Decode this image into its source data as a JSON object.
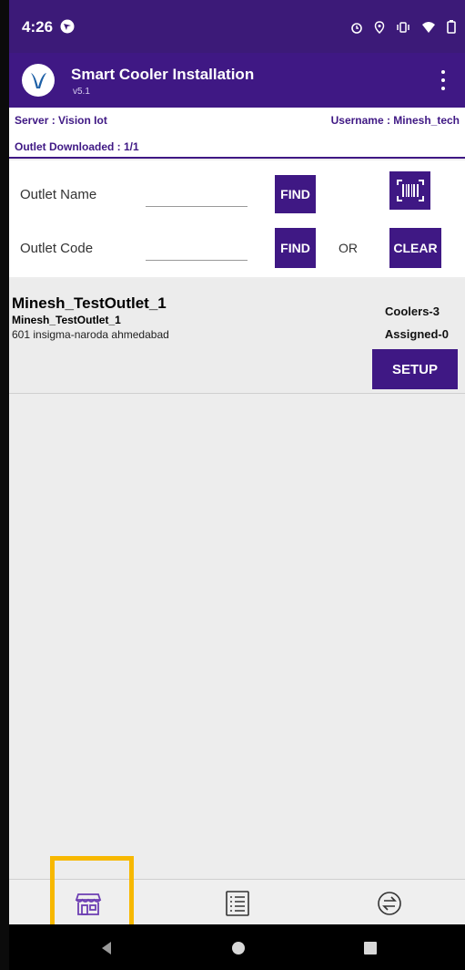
{
  "status_bar": {
    "time": "4:26"
  },
  "app_bar": {
    "title": "Smart Cooler Installation",
    "version": "v5.1"
  },
  "info": {
    "server": "Server : Vision Iot",
    "username": "Username : Minesh_tech",
    "downloaded": "Outlet Downloaded : 1/1"
  },
  "search": {
    "outlet_name_label": "Outlet Name",
    "outlet_name_value": "",
    "outlet_code_label": "Outlet Code",
    "outlet_code_value": "",
    "find_label": "FIND",
    "or_label": "OR",
    "clear_label": "CLEAR"
  },
  "outlet": {
    "name": "Minesh_TestOutlet_1",
    "subname": "Minesh_TestOutlet_1",
    "address": "601 insigma-naroda ahmedabad",
    "coolers": "Coolers-3",
    "assigned": "Assigned-0",
    "setup_label": "SETUP"
  },
  "colors": {
    "primary": "#3f1884",
    "status_bar": "#3c1a78",
    "highlight": "#f7b800"
  },
  "icons": {
    "status_left": "navigation-icon",
    "status_right": [
      "alarm-icon",
      "location-icon",
      "vibrate-icon",
      "wifi-icon",
      "battery-icon"
    ],
    "bottom_nav": [
      "store-icon",
      "list-icon",
      "sync-icon"
    ]
  }
}
